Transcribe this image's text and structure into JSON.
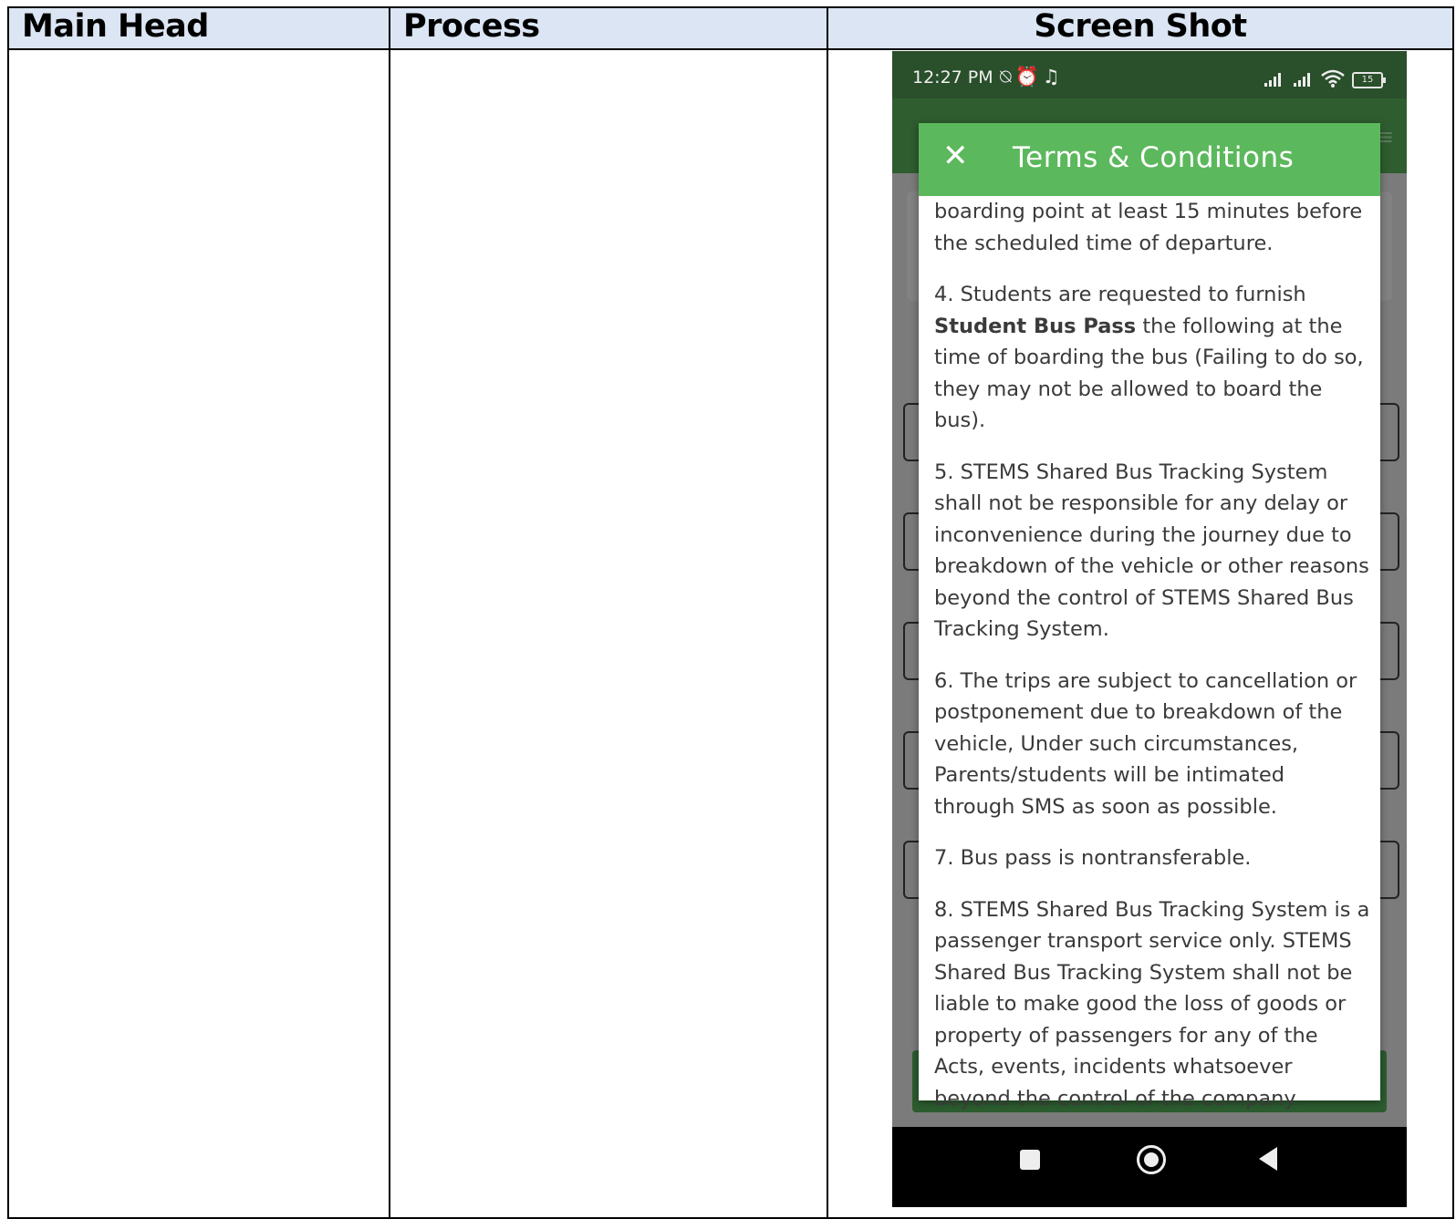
{
  "table": {
    "headers": [
      "Main Head",
      "Process",
      "Screen Shot"
    ],
    "rows": [
      {
        "main_head": "",
        "process": ""
      }
    ]
  },
  "phone": {
    "status_time": "12:27 PM",
    "status_icons": [
      "mute-icon",
      "alarm-icon",
      "headset-icon",
      "signal-icon",
      "signal-icon",
      "wifi-icon",
      "battery-icon"
    ],
    "battery_level": "15",
    "dialog": {
      "title": "Terms & Conditions",
      "close_symbol": "✕",
      "paragraphs": [
        {
          "text": "boarding point at least 15 minutes before the scheduled time of departure."
        },
        {
          "before": "4. Students are requested to furnish ",
          "bold": "Student Bus Pass",
          "after": " the following at the time of boarding the bus (Failing to do so, they may not be allowed to board the bus)."
        },
        {
          "text": "5. STEMS Shared Bus Tracking System shall not be responsible for any delay or inconvenience during the journey due to breakdown of the vehicle or other reasons beyond the control of STEMS Shared Bus Tracking System."
        },
        {
          "text": "6. The trips are subject to cancellation or postponement due to breakdown of the vehicle, Under such circumstances, Parents/students will be intimated through SMS as soon as possible."
        },
        {
          "text": "7. Bus pass is nontransferable."
        },
        {
          "text": "8. STEMS Shared Bus Tracking System is a passenger transport service only. STEMS Shared Bus Tracking System shall not be liable to make good the loss of goods or property of passengers for any of the Acts, events, incidents whatsoever beyond the control of the company."
        }
      ]
    },
    "colors": {
      "status_bar": "#2a4f2b",
      "app_bar": "#2f5d2f",
      "dialog_header": "#5cb85c",
      "overlay": "#7b7b7b",
      "nav_bar": "#000000"
    }
  }
}
